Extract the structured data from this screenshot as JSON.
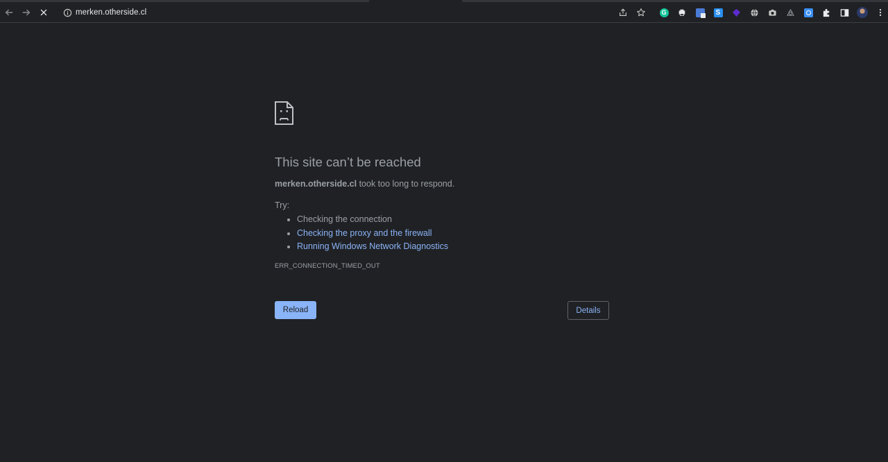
{
  "browser": {
    "url": "merken.otherside.cl",
    "icons": {
      "back": "arrow-left-icon",
      "forward": "arrow-right-icon",
      "stop": "close-icon",
      "site_info": "info-icon",
      "share": "share-icon",
      "bookmark": "star-icon"
    },
    "extensions": [
      {
        "name": "grammarly-extension-icon",
        "color": "#15c39a"
      },
      {
        "name": "printer-extension-icon",
        "color": "#e8eaed"
      },
      {
        "name": "translate-extension-icon",
        "color": "#4a7bd6"
      },
      {
        "name": "s-extension-icon",
        "color": "#2a8ff0"
      },
      {
        "name": "gem-extension-icon",
        "color": "#5b2ccf"
      },
      {
        "name": "globe-extension-icon",
        "color": "#c8c8c8"
      },
      {
        "name": "camera-extension-icon",
        "color": "#c8c8c8"
      },
      {
        "name": "recycle-extension-icon",
        "color": "#c8c8c8"
      },
      {
        "name": "screen-extension-icon",
        "color": "#3b8ff5"
      }
    ]
  },
  "error_page": {
    "heading": "This site can’t be reached",
    "host": "merken.otherside.cl",
    "message_rest": " took too long to respond.",
    "try_label": "Try:",
    "suggestions": [
      "Checking the connection",
      "Checking the proxy and the firewall",
      "Running Windows Network Diagnostics"
    ],
    "error_code": "ERR_CONNECTION_TIMED_OUT",
    "reload_label": "Reload",
    "details_label": "Details",
    "accent_color": "#8ab4f8"
  }
}
